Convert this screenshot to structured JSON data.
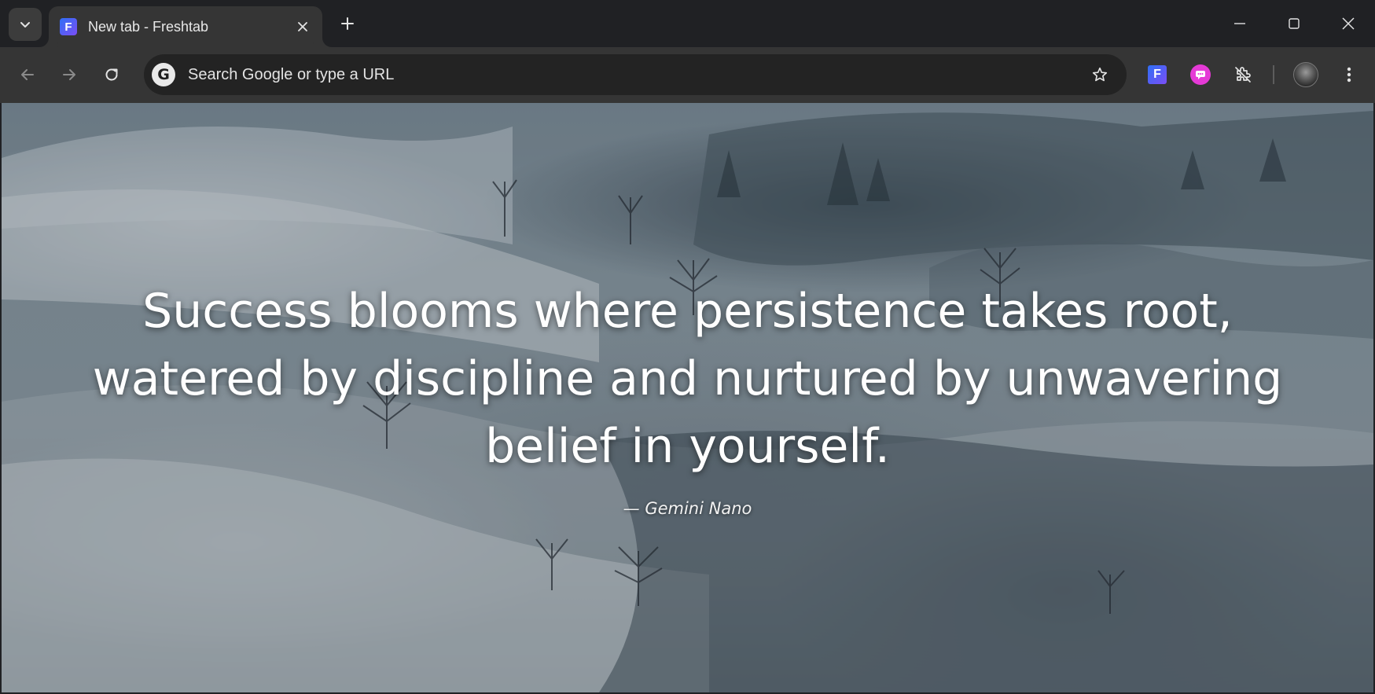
{
  "tab": {
    "favicon_letter": "F",
    "title": "New tab - Freshtab",
    "close_label": "×"
  },
  "new_tab_label": "+",
  "omnibox": {
    "placeholder": "Search Google or type a URL",
    "search_engine_letter": "G"
  },
  "extensions": {
    "freshtab_letter": "F"
  },
  "content": {
    "quote": "Success blooms where persistence takes root, watered by discipline and nurtured by unwavering belief in yourself.",
    "author": "— Gemini Nano"
  },
  "colors": {
    "frame": "#202124",
    "toolbar": "#353535",
    "omnibox": "#232323",
    "accent_freshtab": "#2f6ff5",
    "accent_chat_ext": "#e53ad6"
  }
}
